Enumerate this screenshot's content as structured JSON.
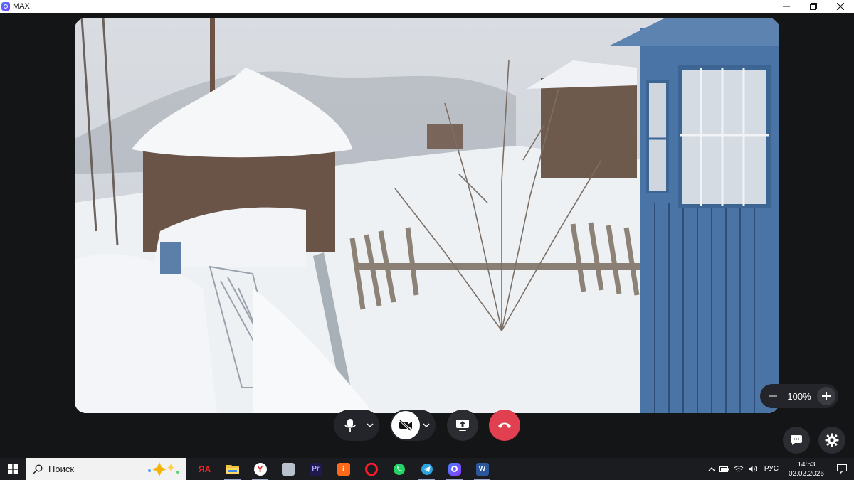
{
  "window": {
    "title": "MAX",
    "minimize_icon": "minimize-icon",
    "restore_icon": "restore-icon",
    "close_icon": "close-icon"
  },
  "video": {
    "content": "snowy-village-scene"
  },
  "zoom": {
    "value": "100%"
  },
  "controls": {
    "mic": {
      "icon": "microphone-icon",
      "menu": "chevron-down-icon"
    },
    "camera": {
      "icon": "camera-off-icon",
      "state": "off",
      "menu": "chevron-down-icon"
    },
    "share": {
      "icon": "screen-share-icon"
    },
    "end_call": {
      "icon": "phone-hangup-icon",
      "color": "#e0404f"
    },
    "chat": {
      "icon": "chat-icon"
    },
    "settings": {
      "icon": "gear-icon"
    }
  },
  "taskbar": {
    "search_placeholder": "Поиск",
    "apps": [
      {
        "name": "app-red-logo",
        "active": false
      },
      {
        "name": "file-explorer",
        "active": true
      },
      {
        "name": "yandex-browser",
        "active": true
      },
      {
        "name": "app-gray",
        "active": false
      },
      {
        "name": "premiere-pro",
        "active": false
      },
      {
        "name": "app-orange",
        "active": false
      },
      {
        "name": "opera",
        "active": false
      },
      {
        "name": "whatsapp",
        "active": false
      },
      {
        "name": "telegram",
        "active": true
      },
      {
        "name": "max",
        "active": true
      },
      {
        "name": "word",
        "active": true
      }
    ],
    "tray": {
      "language": "РУС",
      "time": "14:53",
      "date": "02.02.2026"
    }
  }
}
